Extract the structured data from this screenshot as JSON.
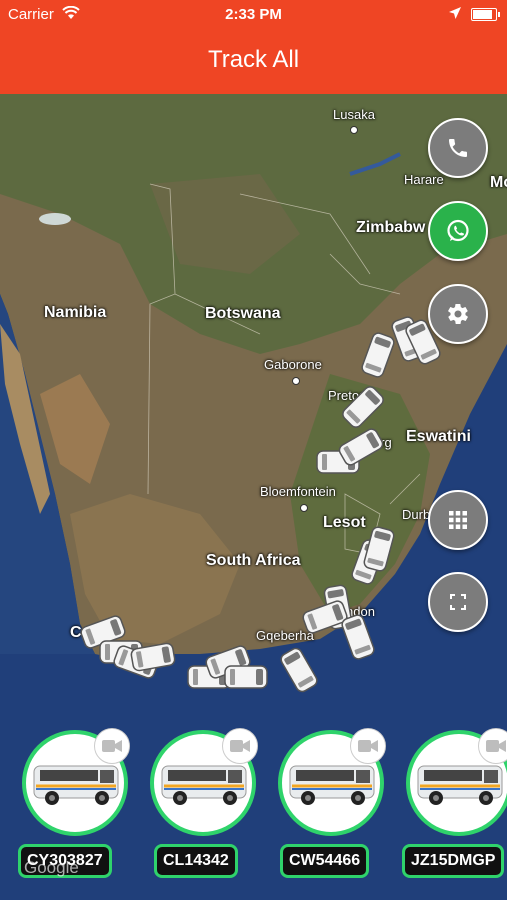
{
  "status": {
    "carrier": "Carrier",
    "time": "2:33 PM",
    "battery_level": 0.85
  },
  "nav": {
    "title": "Track All"
  },
  "map": {
    "labels": {
      "lusaka": "Lusaka",
      "harare": "Harare",
      "mo": "Mo",
      "zimbabwe": "Zimbabw",
      "namibia": "Namibia",
      "botswana": "Botswana",
      "gaborone": "Gaborone",
      "pretoria": "Pretoria",
      "johannesburg": "esburg",
      "eswatini": "Eswatini",
      "bloemfontein": "Bloemfontein",
      "lesotho": "Lesot",
      "durban": "Durb",
      "south_africa": "South Africa",
      "london": "ndon",
      "gqeberha": "Gqeberha",
      "cape": "C"
    },
    "attribution": "Google"
  },
  "actions": [
    {
      "name": "call-button",
      "icon": "phone-icon"
    },
    {
      "name": "whatsapp-button",
      "icon": "whatsapp-icon"
    },
    {
      "name": "settings-button",
      "icon": "gear-icon"
    },
    {
      "name": "grid-view-button",
      "icon": "grid-icon"
    },
    {
      "name": "fullscreen-button",
      "icon": "fullscreen-icon"
    }
  ],
  "vehicles": [
    {
      "plate": "CY303827"
    },
    {
      "plate": "CL14342"
    },
    {
      "plate": "CW54466"
    },
    {
      "plate": "JZ15DMGP"
    }
  ],
  "colors": {
    "brand": "#ef4524",
    "accent_green": "#2fd36b",
    "whatsapp_green": "#2ab24b",
    "fab_grey": "#7c7c7c"
  }
}
